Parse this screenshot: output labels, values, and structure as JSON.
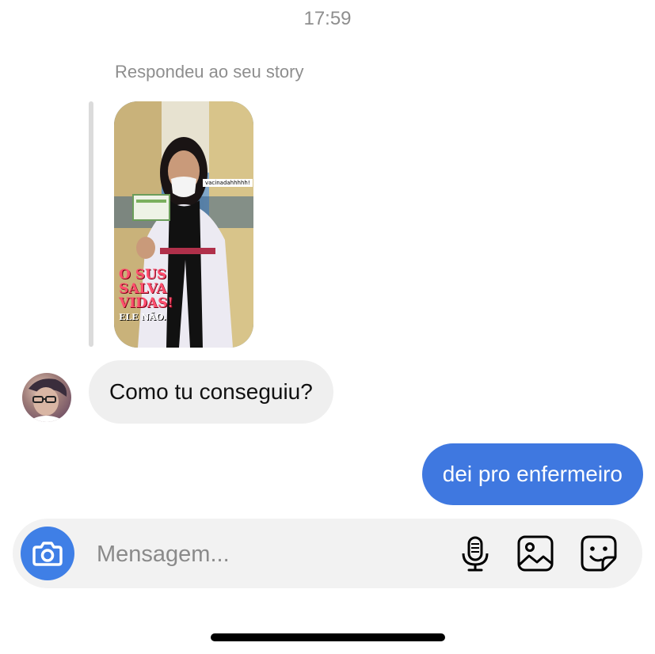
{
  "status": {
    "time": "17:59"
  },
  "story_reply": {
    "label": "Respondeu ao seu story",
    "sticker_text": "vacinadahhhhh!",
    "caption_lines": [
      "O SUS",
      "SALVA",
      "VIDAS!"
    ],
    "caption_small": "ELE NÃO."
  },
  "messages": [
    {
      "direction": "incoming",
      "text": "Como tu conseguiu?"
    },
    {
      "direction": "outgoing",
      "text": "dei pro enfermeiro"
    }
  ],
  "composer": {
    "placeholder": "Mensagem...",
    "icons": [
      "camera-icon",
      "microphone-icon",
      "gallery-icon",
      "sticker-icon"
    ]
  },
  "colors": {
    "outgoing_bubble": "#3f78e0",
    "incoming_bubble": "#efefef",
    "camera_button": "#3f7fe6"
  }
}
